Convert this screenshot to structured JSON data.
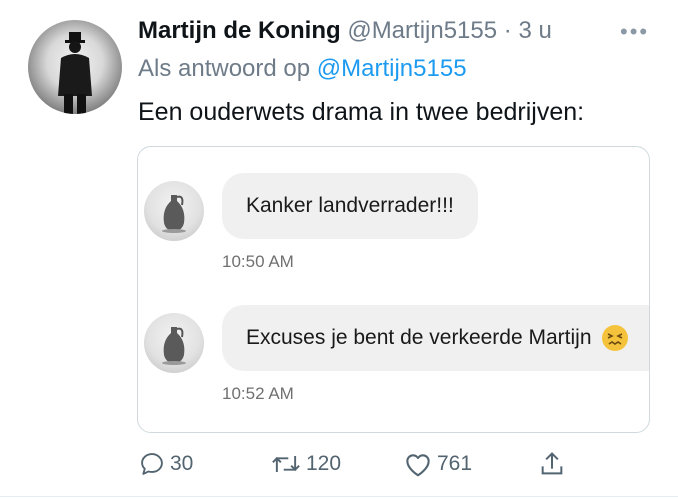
{
  "tweet": {
    "author_name": "Martijn de Koning",
    "author_handle": "@Martijn5155",
    "separator": "·",
    "time": "3 u",
    "more_label": "•••",
    "reply_prefix": "Als antwoord op",
    "reply_to": "@Martijn5155",
    "text": "Een ouderwets drama in twee bedrijven:"
  },
  "media": {
    "messages": [
      {
        "text": "Kanker landverrader!!!",
        "time": "10:50 AM"
      },
      {
        "text": "Excuses je bent de verkeerde Martijn",
        "time": "10:52 AM",
        "emoji": "confounded-face"
      }
    ]
  },
  "actions": {
    "reply_count": "30",
    "retweet_count": "120",
    "like_count": "761"
  },
  "colors": {
    "link": "#1d9bf0",
    "secondary_text": "#6e7b88",
    "bubble": "#f0f0f1",
    "card_border": "#cfd9de"
  }
}
